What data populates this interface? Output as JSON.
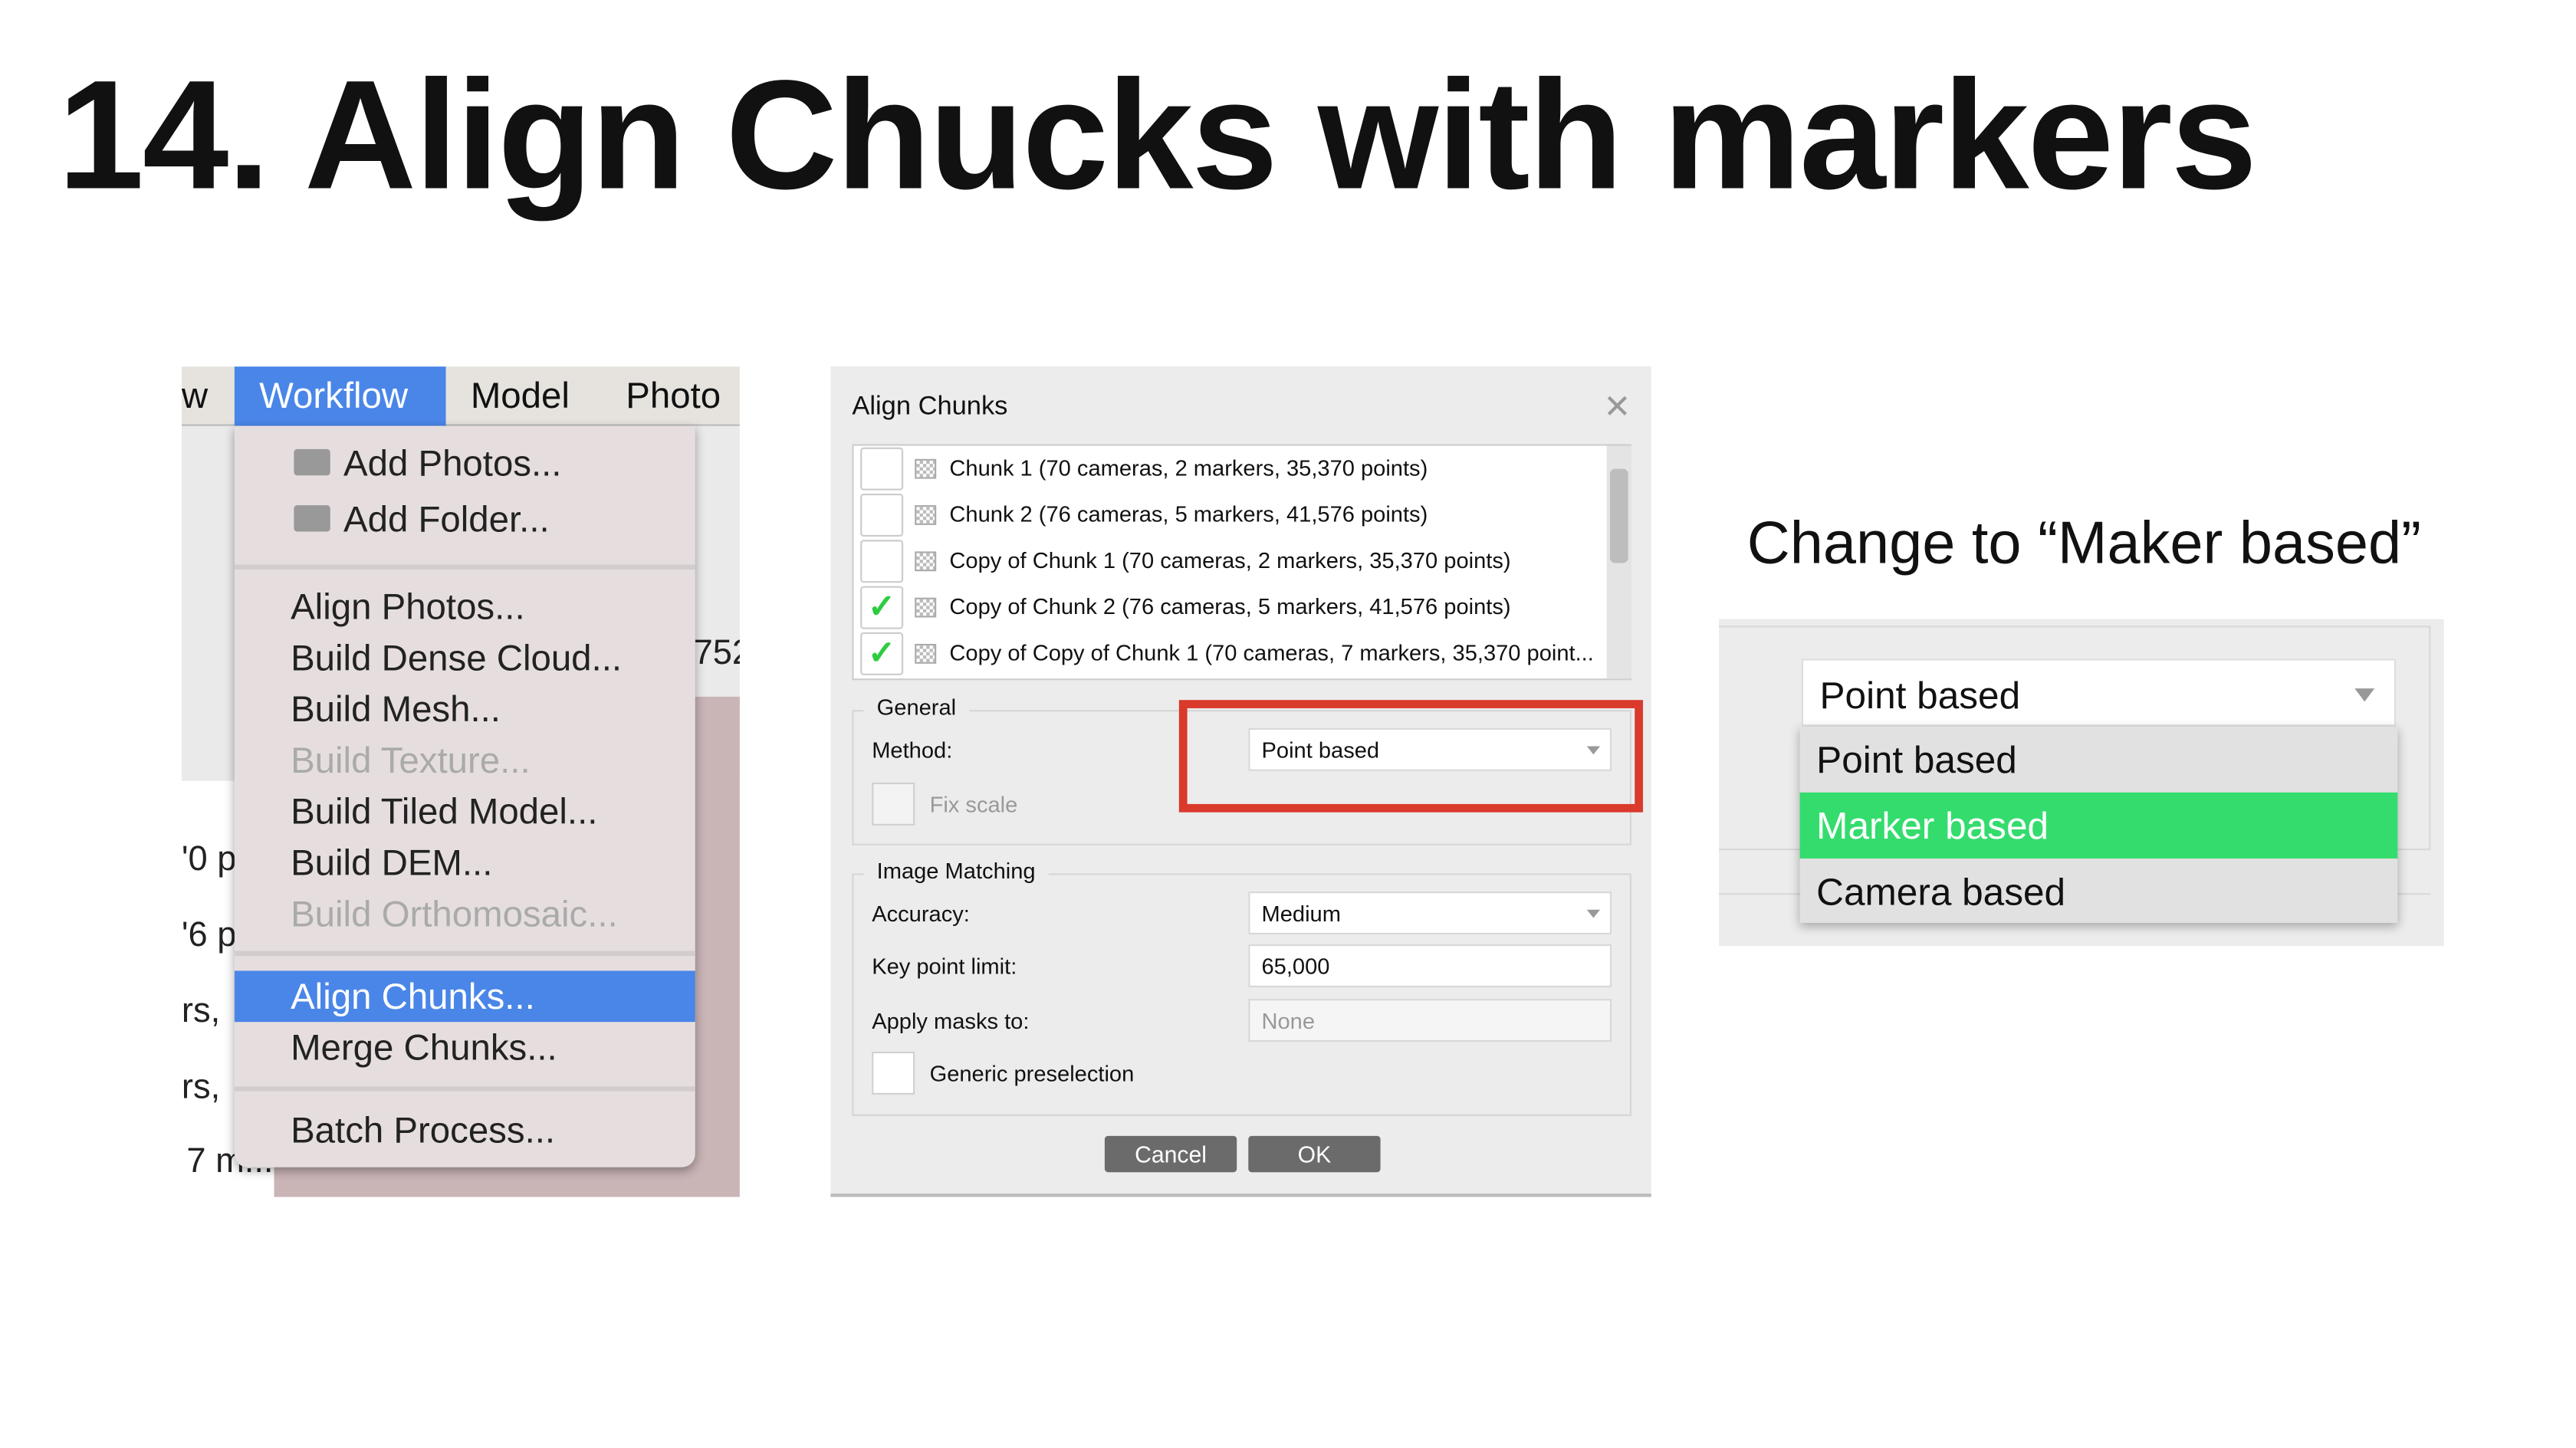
{
  "slide_title": "14. Align Chucks with markers",
  "menubar": {
    "partial": "w",
    "items": [
      "Workflow",
      "Model",
      "Photo"
    ],
    "active": "Workflow"
  },
  "background_fragments": [
    "752",
    "'0 p",
    "'6 p",
    "rs,",
    "rs,",
    "7 m..."
  ],
  "workflow_menu": {
    "items": [
      {
        "label": "Add Photos...",
        "icon": "add-photos-icon",
        "enabled": true
      },
      {
        "label": "Add Folder...",
        "icon": "add-folder-icon",
        "enabled": true
      },
      {
        "label": "Align Photos...",
        "enabled": true
      },
      {
        "label": "Build Dense Cloud...",
        "enabled": true
      },
      {
        "label": "Build Mesh...",
        "enabled": true
      },
      {
        "label": "Build Texture...",
        "enabled": false
      },
      {
        "label": "Build Tiled Model...",
        "enabled": true
      },
      {
        "label": "Build DEM...",
        "enabled": true
      },
      {
        "label": "Build Orthomosaic...",
        "enabled": false
      },
      {
        "label": "Align Chunks...",
        "enabled": true,
        "highlighted": true
      },
      {
        "label": "Merge Chunks...",
        "enabled": true
      },
      {
        "label": "Batch Process...",
        "enabled": true
      }
    ],
    "highlight_color": "#4a86e8"
  },
  "dialog": {
    "title": "Align Chunks",
    "chunks": [
      {
        "label": "Chunk 1 (70 cameras, 2 markers, 35,370 points)",
        "checked": false
      },
      {
        "label": "Chunk 2 (76 cameras, 5 markers, 41,576 points)",
        "checked": false
      },
      {
        "label": "Copy of Chunk 1 (70 cameras, 2 markers, 35,370 points)",
        "checked": false
      },
      {
        "label": "Copy of Chunk 2 (76 cameras, 5 markers, 41,576 points)",
        "checked": true
      },
      {
        "label": "Copy of Copy of Chunk 1 (70 cameras, 7 markers, 35,370 point...",
        "checked": true
      }
    ],
    "general": {
      "label": "General",
      "method_label": "Method:",
      "method_value": "Point based",
      "fix_scale_label": "Fix scale"
    },
    "image_matching": {
      "label": "Image Matching",
      "accuracy_label": "Accuracy:",
      "accuracy_value": "Medium",
      "keypoint_label": "Key point limit:",
      "keypoint_value": "65,000",
      "masks_label": "Apply masks to:",
      "masks_value": "None",
      "generic_label": "Generic preselection"
    },
    "cancel_label": "Cancel",
    "ok_label": "OK",
    "annotation_color": "#d93a2b"
  },
  "hint": {
    "text": "Change to “Maker based”",
    "select_value": "Point based",
    "options": [
      "Point based",
      "Marker based",
      "Camera based"
    ],
    "highlighted": "Marker based",
    "highlight_color": "#34dc6d"
  }
}
